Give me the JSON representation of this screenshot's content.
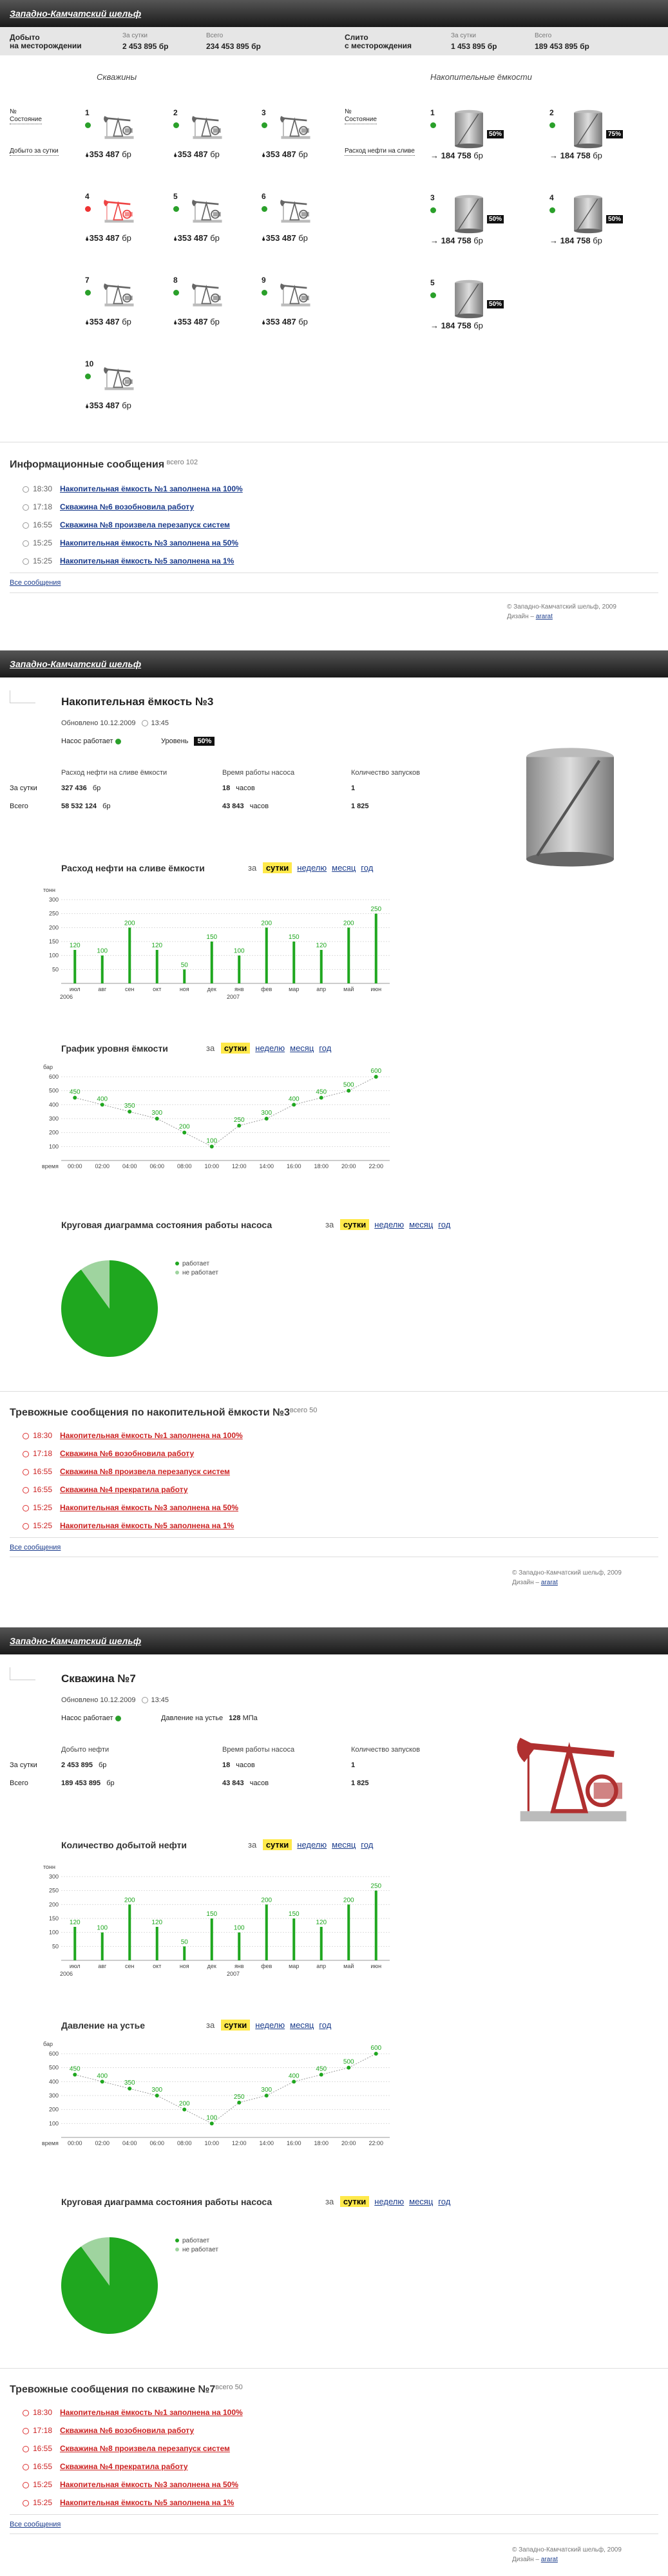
{
  "logo": "Западно-Камчатский шельф",
  "summary": {
    "mined_label": "Добыто\nна месторождении",
    "mined_label1": "Добыто",
    "mined_label2": "на месторождении",
    "day_label": "За сутки",
    "day_val": "2 453 895 бр",
    "total_label": "Всего",
    "total_val": "234 453 895 бр",
    "drained_label1": "Слито",
    "drained_label2": "с месторождения",
    "d_day_label": "За сутки",
    "d_day_val": "1 453 895 бр",
    "d_total_label": "Всего",
    "d_total_val": "189 453 895 бр"
  },
  "wells_title": "Скважины",
  "tanks_title": "Накопительные ёмкости",
  "wells_side": {
    "no": "№",
    "state": "Состояние",
    "mined": "Добыто за сутки"
  },
  "tanks_side": {
    "no": "№",
    "state": "Состояние",
    "flow": "Расход нефти на сливе"
  },
  "wells": [
    {
      "n": "1",
      "val": "353 487",
      "u": "бр",
      "st": "ok"
    },
    {
      "n": "2",
      "val": "353 487",
      "u": "бр",
      "st": "ok"
    },
    {
      "n": "3",
      "val": "353 487",
      "u": "бр",
      "st": "ok"
    },
    {
      "n": "4",
      "val": "353 487",
      "u": "бр",
      "st": "err"
    },
    {
      "n": "5",
      "val": "353 487",
      "u": "бр",
      "st": "ok"
    },
    {
      "n": "6",
      "val": "353 487",
      "u": "бр",
      "st": "ok"
    },
    {
      "n": "7",
      "val": "353 487",
      "u": "бр",
      "st": "ok"
    },
    {
      "n": "8",
      "val": "353 487",
      "u": "бр",
      "st": "ok"
    },
    {
      "n": "9",
      "val": "353 487",
      "u": "бр",
      "st": "ok"
    },
    {
      "n": "10",
      "val": "353 487",
      "u": "бр",
      "st": "ok"
    }
  ],
  "tanks": [
    {
      "n": "1",
      "val": "184 758",
      "u": "бр",
      "pct": "50%"
    },
    {
      "n": "2",
      "val": "184 758",
      "u": "бр",
      "pct": "75%"
    },
    {
      "n": "3",
      "val": "184 758",
      "u": "бр",
      "pct": "50%"
    },
    {
      "n": "4",
      "val": "184 758",
      "u": "бр",
      "pct": "50%"
    },
    {
      "n": "5",
      "val": "184 758",
      "u": "бр",
      "pct": "50%"
    }
  ],
  "info": {
    "title": "Информационные сообщения",
    "count": "всего 102",
    "all": "Все сообщения",
    "items": [
      {
        "t": "18:30",
        "m": "Накопительная ёмкость №1 заполнена на 100%"
      },
      {
        "t": "17:18",
        "m": "Скважина №6 возобновила работу"
      },
      {
        "t": "16:55",
        "m": "Скважина №8 произвела перезапуск систем"
      },
      {
        "t": "15:25",
        "m": "Накопительная ёмкость №3 заполнена на 50%"
      },
      {
        "t": "15:25",
        "m": "Накопительная ёмкость №5 заполнена на 1%"
      }
    ]
  },
  "footer": {
    "copy": "© Западно-Камчатский шельф, 2009",
    "design": "Дизайн –",
    "studio": "ararat"
  },
  "tank3": {
    "title": "Накопительная ёмкость №3",
    "updated": "Обновлено 10.12.2009",
    "time": "13:45",
    "pump": "Насос работает",
    "level_label": "Уровень",
    "level": "50%",
    "h1": "Расход нефти на сливе ёмкости",
    "h2": "Время работы насоса",
    "h3": "Количество запусков",
    "r1": "За сутки",
    "r2": "Всего",
    "d1": "327 436",
    "d1u": "бр",
    "d2": "18",
    "d2u": "часов",
    "d3": "1",
    "t1": "58 532 124",
    "t1u": "бр",
    "t2": "43 843",
    "t2u": "часов",
    "t3": "1 825",
    "c1": "Расход нефти на сливе ёмкости",
    "c2": "График уровня ёмкости",
    "c3": "Круговая диаграмма состояния работы насоса",
    "alerts_title": "Тревожные сообщения по накопительной ёмкости №3",
    "alerts_count": "всего 50"
  },
  "well7": {
    "title": "Скважина №7",
    "updated": "Обновлено 10.12.2009",
    "time": "13:45",
    "pump": "Насос работает",
    "press_label": "Давление на устье",
    "press": "128",
    "press_u": "МПа",
    "h1": "Добыто нефти",
    "h2": "Время работы насоса",
    "h3": "Количество запусков",
    "r1": "За сутки",
    "r2": "Всего",
    "d1": "2 453 895",
    "d1u": "бр",
    "d2": "18",
    "d2u": "часов",
    "d3": "1",
    "t1": "189 453 895",
    "t1u": "бр",
    "t2": "43 843",
    "t2u": "часов",
    "t3": "1 825",
    "c1": "Количество добытой нефти",
    "c2": "Давление на устье",
    "c3": "Круговая диаграмма состояния работы насоса",
    "alerts_title": "Тревожные сообщения по скважине №7",
    "alerts_count": "всего 50"
  },
  "period": {
    "za": "за",
    "p1": "сутки",
    "p2": "неделю",
    "p3": "месяц",
    "p4": "год"
  },
  "pie_legend": {
    "a": "работает",
    "b": "не работает"
  },
  "alerts": [
    {
      "t": "18:30",
      "m": "Накопительная ёмкость №1 заполнена на 100%"
    },
    {
      "t": "17:18",
      "m": "Скважина №6 возобновила работу"
    },
    {
      "t": "16:55",
      "m": "Скважина №8 произвела перезапуск систем"
    },
    {
      "t": "16:55",
      "m": "Скважина №4 прекратила работу"
    },
    {
      "t": "15:25",
      "m": "Накопительная ёмкость №3 заполнена на 50%"
    },
    {
      "t": "15:25",
      "m": "Накопительная ёмкость №5 заполнена на 1%"
    }
  ],
  "all_msgs": "Все сообщения",
  "chart_data": [
    {
      "type": "bar",
      "ylabel": "тонн",
      "categories": [
        "июл",
        "авг",
        "сен",
        "окт",
        "ноя",
        "дек",
        "янв",
        "фев",
        "мар",
        "апр",
        "май",
        "июн"
      ],
      "year_labels": [
        "2006",
        "2007"
      ],
      "values": [
        120,
        100,
        200,
        120,
        50,
        150,
        100,
        200,
        150,
        120,
        200,
        250
      ],
      "ylim": [
        0,
        300
      ],
      "yticks": [
        50,
        100,
        150,
        200,
        250,
        300
      ]
    },
    {
      "type": "line",
      "ylabel": "бар",
      "xlabel": "время",
      "categories": [
        "00:00",
        "02:00",
        "04:00",
        "06:00",
        "08:00",
        "10:00",
        "12:00",
        "14:00",
        "16:00",
        "18:00",
        "20:00",
        "22:00"
      ],
      "values": [
        450,
        400,
        350,
        300,
        200,
        100,
        250,
        300,
        400,
        450,
        500,
        600
      ],
      "ylim": [
        0,
        600
      ],
      "yticks": [
        100,
        200,
        300,
        400,
        500,
        600
      ]
    },
    {
      "type": "pie",
      "slices": [
        {
          "name": "работает",
          "value": 90
        },
        {
          "name": "не работает",
          "value": 10
        }
      ]
    },
    {
      "type": "bar",
      "ylabel": "тонн",
      "categories": [
        "июл",
        "авг",
        "сен",
        "окт",
        "ноя",
        "дек",
        "янв",
        "фев",
        "мар",
        "апр",
        "май",
        "июн"
      ],
      "year_labels": [
        "2006",
        "2007"
      ],
      "values": [
        120,
        100,
        200,
        120,
        50,
        150,
        100,
        200,
        150,
        120,
        200,
        250
      ],
      "ylim": [
        0,
        300
      ],
      "yticks": [
        50,
        100,
        150,
        200,
        250,
        300
      ]
    },
    {
      "type": "line",
      "ylabel": "бар",
      "xlabel": "время",
      "categories": [
        "00:00",
        "02:00",
        "04:00",
        "06:00",
        "08:00",
        "10:00",
        "12:00",
        "14:00",
        "16:00",
        "18:00",
        "20:00",
        "22:00"
      ],
      "values": [
        450,
        400,
        350,
        300,
        200,
        100,
        250,
        300,
        400,
        450,
        500,
        600
      ],
      "ylim": [
        0,
        600
      ],
      "yticks": [
        100,
        200,
        300,
        400,
        500,
        600
      ]
    },
    {
      "type": "pie",
      "slices": [
        {
          "name": "работает",
          "value": 90
        },
        {
          "name": "не работает",
          "value": 10
        }
      ]
    }
  ]
}
